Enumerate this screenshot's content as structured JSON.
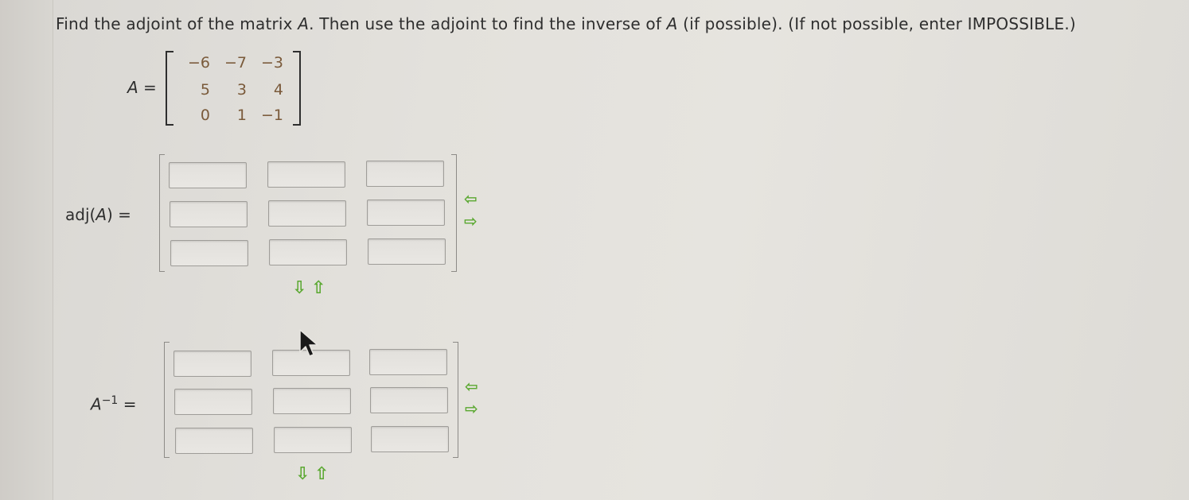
{
  "question": {
    "part1": "Find the adjoint of the matrix ",
    "var1": "A",
    "part2": ". Then use the adjoint to find the inverse of ",
    "var2": "A",
    "part3": " (if possible). (If not possible, enter IMPOSSIBLE.)"
  },
  "matrix_A": {
    "label_var": "A",
    "label_eq": "=",
    "rows": [
      [
        "−6",
        "−7",
        "−3"
      ],
      [
        "5",
        "3",
        "4"
      ],
      [
        "0",
        "1",
        "−1"
      ]
    ]
  },
  "adjoint": {
    "label_fn": "adj(",
    "label_var": "A",
    "label_close": ") =",
    "values": [
      "",
      "",
      "",
      "",
      "",
      "",
      "",
      "",
      ""
    ]
  },
  "inverse": {
    "label_var": "A",
    "label_sup": "−1",
    "label_eq": "=",
    "values": [
      "",
      "",
      "",
      "",
      "",
      "",
      "",
      "",
      ""
    ]
  },
  "controls": {
    "arrow_left": "⇦",
    "arrow_right": "⇨",
    "arrow_down": "⇩",
    "arrow_up": "⇧"
  },
  "colors": {
    "arrow": "#5aa830",
    "matrix_entries": "#7a5a3a"
  }
}
